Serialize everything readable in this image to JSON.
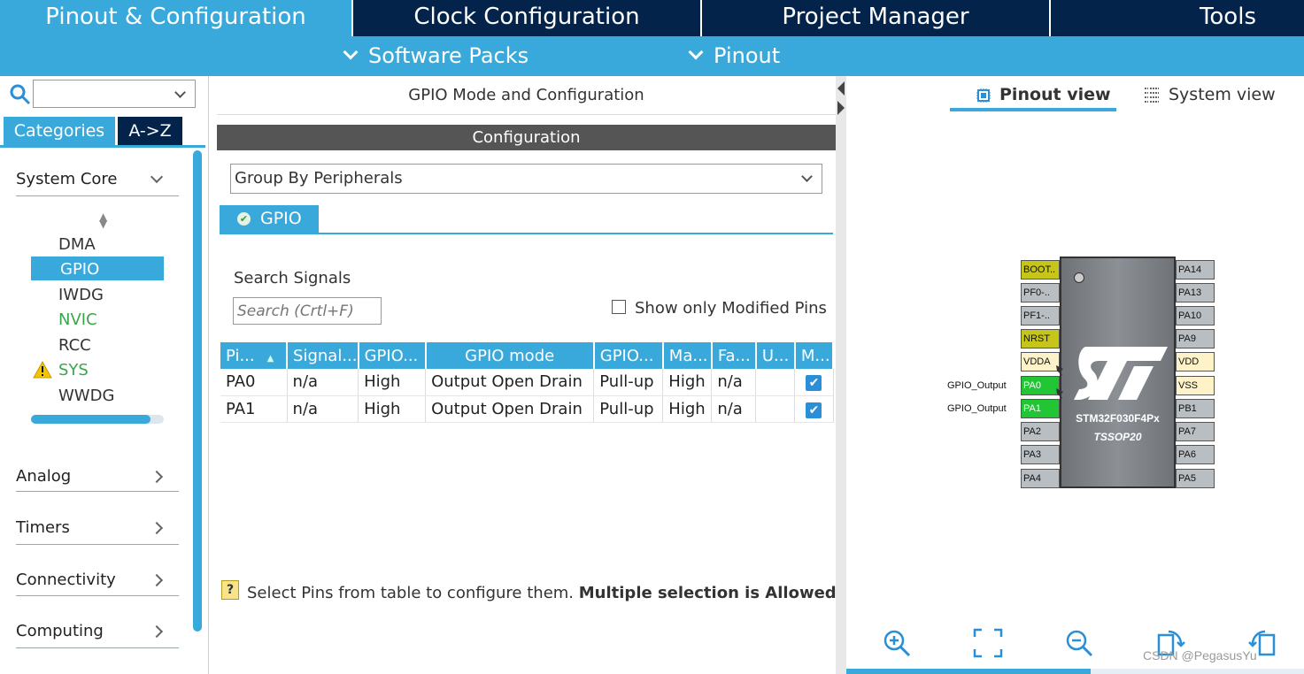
{
  "top_tabs": [
    "Pinout & Configuration",
    "Clock Configuration",
    "Project Manager",
    "Tools"
  ],
  "sub_menu": [
    "Software Packs",
    "Pinout"
  ],
  "left": {
    "search_value": "",
    "tabs": [
      "Categories",
      "A->Z"
    ],
    "groups": {
      "system_core": "System Core",
      "analog": "Analog",
      "timers": "Timers",
      "connectivity": "Connectivity",
      "computing": "Computing"
    },
    "system_core_items": [
      "DMA",
      "GPIO",
      "IWDG",
      "NVIC",
      "RCC",
      "SYS",
      "WWDG"
    ]
  },
  "middle": {
    "title": "GPIO Mode and Configuration",
    "config_header": "Configuration",
    "group_by": "Group By Peripherals",
    "gpio_tab": "GPIO",
    "search_label": "Search Signals",
    "search_placeholder": "Search (Crtl+F)",
    "show_modified": "Show only Modified Pins",
    "columns": [
      "Pi...",
      "Signal...",
      "GPIO...",
      "GPIO mode",
      "GPIO...",
      "Ma...",
      "Fa...",
      "U...",
      "M..."
    ],
    "rows": [
      [
        "PA0",
        "n/a",
        "High",
        "Output Open Drain",
        "Pull-up",
        "High",
        "n/a",
        "",
        "checked"
      ],
      [
        "PA1",
        "n/a",
        "High",
        "Output Open Drain",
        "Pull-up",
        "High",
        "n/a",
        "",
        "checked"
      ]
    ],
    "hint_text": "Select Pins from table to configure them.",
    "hint_bold": "Multiple selection is Allowed."
  },
  "right": {
    "tab_pinout": "Pinout view",
    "tab_system": "System view",
    "chip_name": "STM32F030F4Px",
    "chip_package": "TSSOP20",
    "left_pins": [
      "BOOT..",
      "PF0-..",
      "PF1-..",
      "NRST",
      "VDDA",
      "PA0",
      "PA1",
      "PA2",
      "PA3",
      "PA4"
    ],
    "right_pins": [
      "PA14",
      "PA13",
      "PA10",
      "PA9",
      "VDD",
      "VSS",
      "PB1",
      "PA7",
      "PA6",
      "PA5"
    ],
    "pin_labels": [
      "GPIO_Output",
      "GPIO_Output"
    ],
    "watermark": "CSDN @PegasusYu"
  },
  "colors": {
    "nav_dark": "#03234b",
    "accent_blue": "#39a9dc",
    "pin_green": "#22c533",
    "pin_olive": "#c5c51a",
    "nvic_green": "#3aa64a"
  }
}
